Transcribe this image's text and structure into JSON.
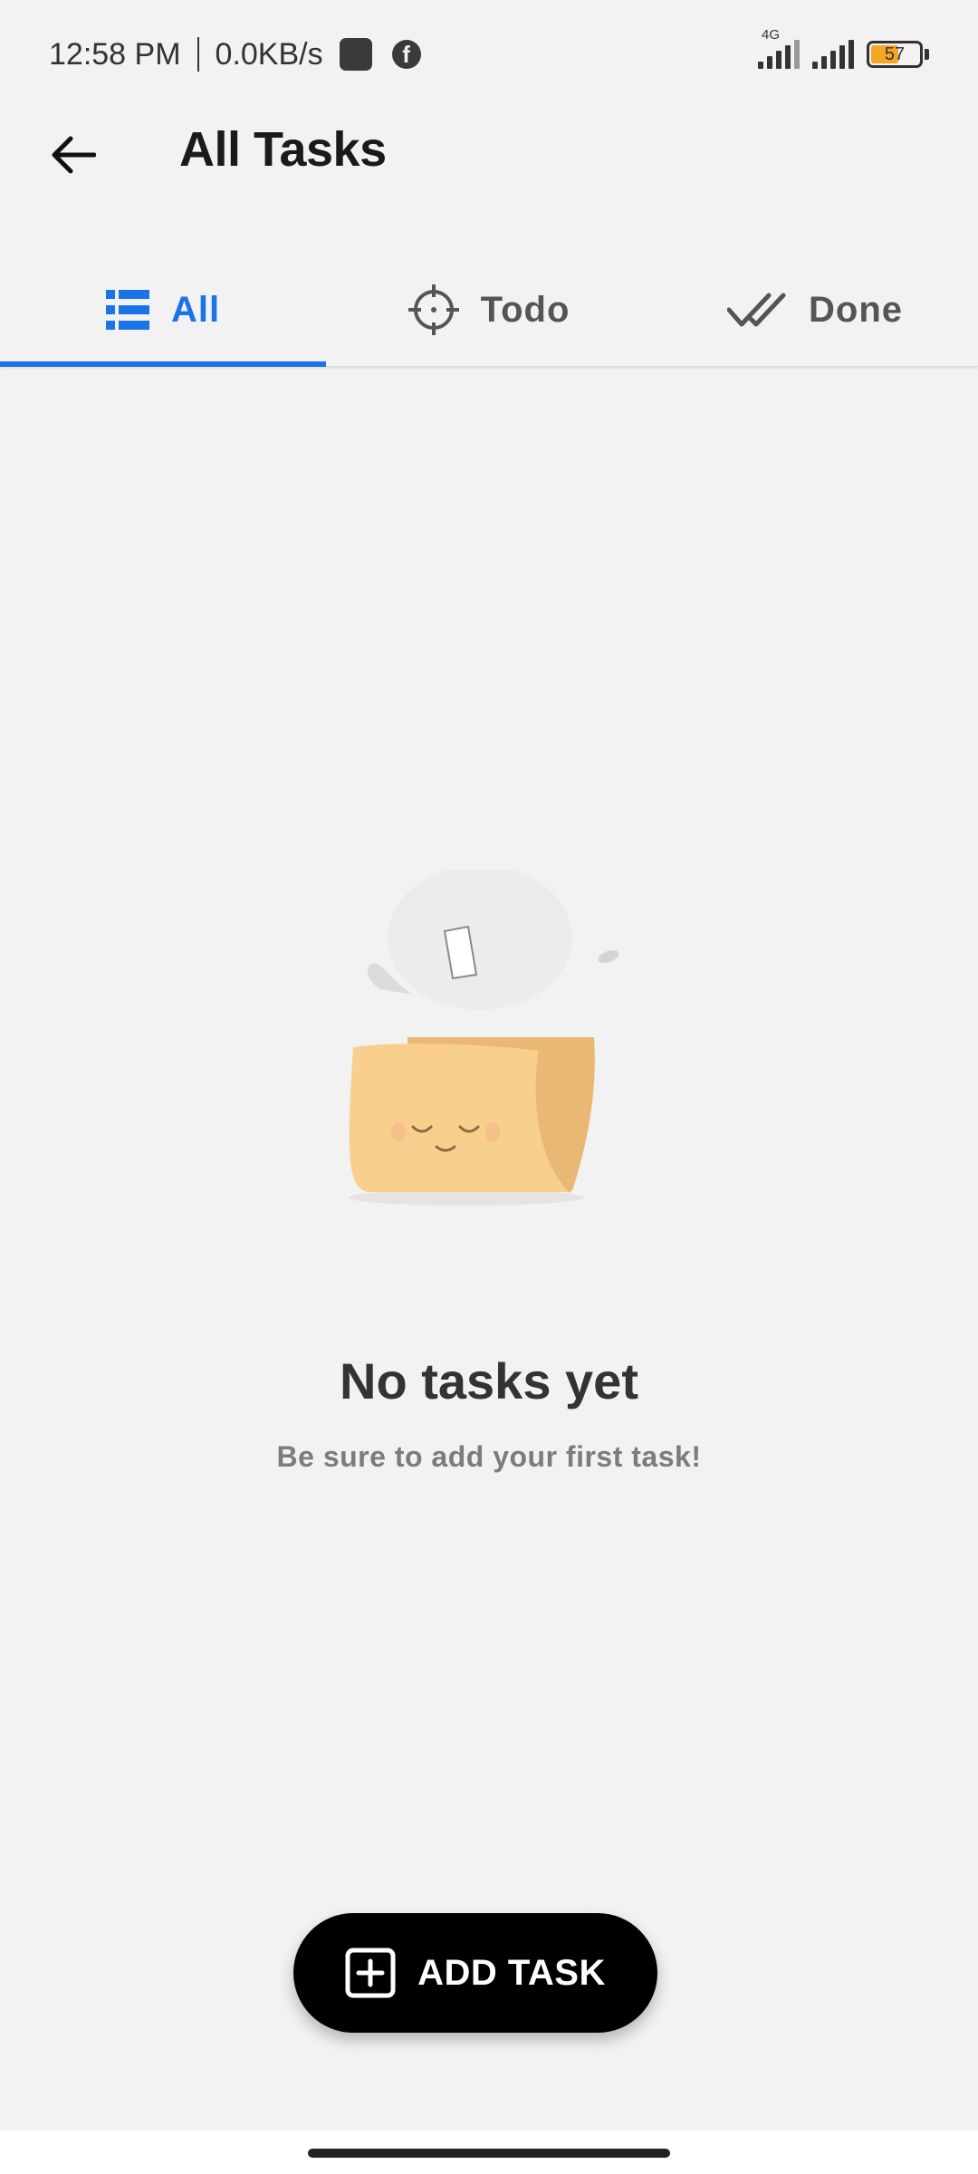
{
  "status_bar": {
    "time": "12:58 PM",
    "net_speed": "0.0KB/s",
    "network_type": "4G",
    "battery_level": "57",
    "icons": [
      "app-square-icon",
      "facebook-icon",
      "signal-4g-icon",
      "signal-icon",
      "battery-icon"
    ]
  },
  "app_bar": {
    "title": "All Tasks",
    "back_icon": "arrow-left-icon"
  },
  "tabs": [
    {
      "label": "All",
      "icon": "list-icon",
      "active": true
    },
    {
      "label": "Todo",
      "icon": "crosshair-icon",
      "active": false
    },
    {
      "label": "Done",
      "icon": "double-check-icon",
      "active": false
    }
  ],
  "empty_state": {
    "illustration": "sleepy-folder-illustration",
    "title": "No tasks yet",
    "subtitle": "Be sure to add your first task!"
  },
  "fab": {
    "label": "ADD TASK",
    "icon": "plus-square-icon"
  },
  "colors": {
    "accent": "#1a73e8",
    "background": "#f2f2f2",
    "fab_bg": "#000000",
    "battery": "#f5a623",
    "folder": "#f9cf8d"
  }
}
